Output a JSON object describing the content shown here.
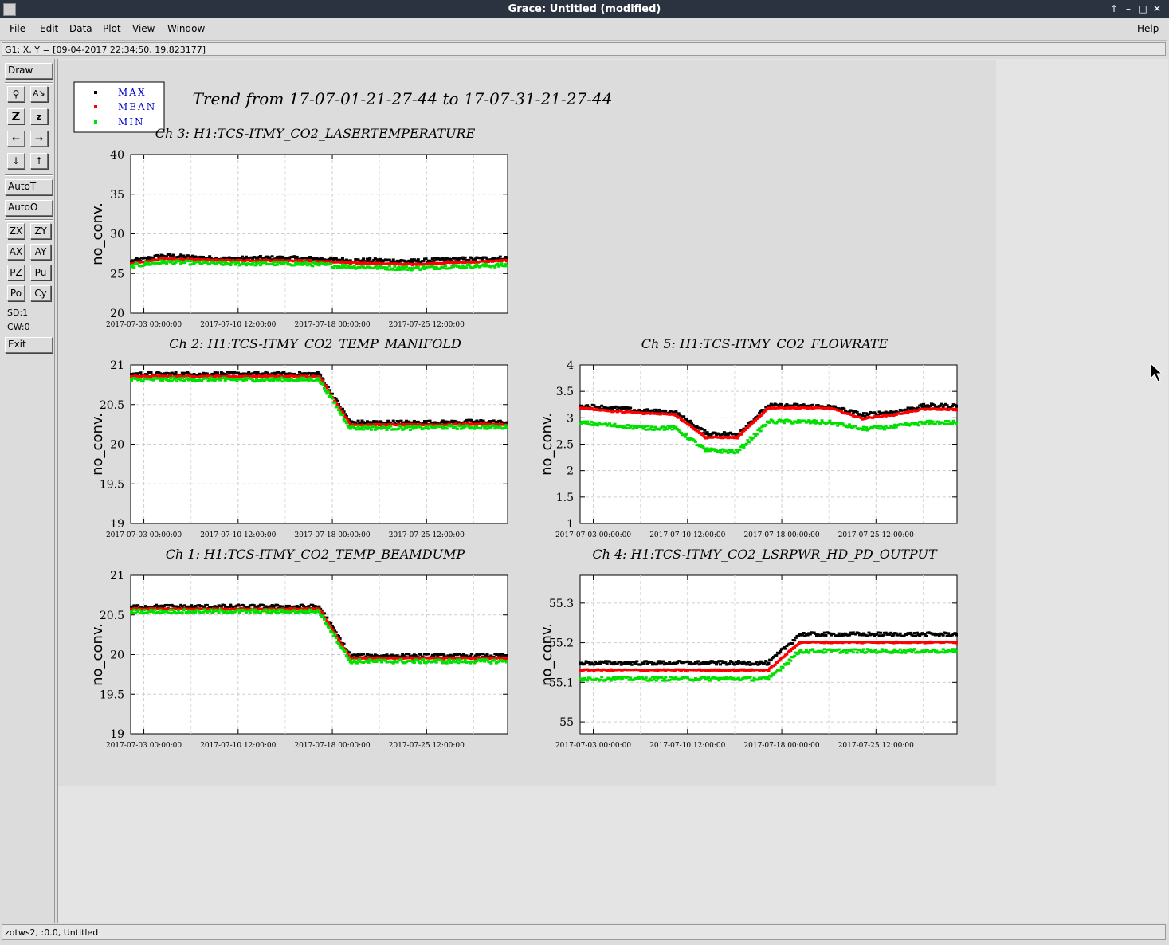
{
  "window": {
    "title": "Grace: Untitled (modified)"
  },
  "menu": {
    "file": "File",
    "edit": "Edit",
    "data": "Data",
    "plot": "Plot",
    "view": "View",
    "window": "Window",
    "help": "Help"
  },
  "locator": "G1: X, Y = [09-04-2017 22:34:50, 19.823177]",
  "toolbar": {
    "draw": "Draw",
    "autot": "AutoT",
    "autoo": "AutoO",
    "zx": "ZX",
    "zy": "ZY",
    "ax": "AX",
    "ay": "AY",
    "pz": "PZ",
    "pu": "Pu",
    "po": "Po",
    "cy": "Cy",
    "sd": "SD:1",
    "cw": "CW:0",
    "exit": "Exit"
  },
  "status": "zotws2, :0.0, Untitled",
  "plot": {
    "main_title": "Trend from 17-07-01-21-27-44 to 17-07-31-21-27-44",
    "legend": [
      "MAX",
      "MEAN",
      "MIN"
    ],
    "colors": {
      "max": "#000000",
      "mean": "#ff0000",
      "min": "#00e000",
      "legend_text": "#0000cc"
    }
  },
  "chart_data": [
    {
      "type": "scatter",
      "title": "Ch 3: H1:TCS-ITMY_CO2_LASERTEMPERATURE",
      "ylabel": "no_conv.",
      "ylim": [
        20,
        40
      ],
      "yticks": [
        "20",
        "25",
        "30",
        "35",
        "40"
      ],
      "xticks": [
        "2017-07-03 00:00:00",
        "2017-07-10 12:00:00",
        "2017-07-18 00:00:00",
        "2017-07-25 12:00:00"
      ],
      "grid": true,
      "series": [
        {
          "name": "MAX",
          "color": "#000000",
          "values": [
            26.5,
            27.2,
            27.0,
            26.8,
            26.9,
            26.9,
            26.8,
            26.6,
            26.6,
            26.5,
            26.7,
            26.8,
            26.9
          ]
        },
        {
          "name": "MEAN",
          "color": "#ff0000",
          "values": [
            26.2,
            26.8,
            26.7,
            26.6,
            26.6,
            26.6,
            26.5,
            26.3,
            26.2,
            26.1,
            26.3,
            26.4,
            26.6
          ]
        },
        {
          "name": "MIN",
          "color": "#00e000",
          "values": [
            25.9,
            26.4,
            26.3,
            26.2,
            26.2,
            26.2,
            26.1,
            25.8,
            25.7,
            25.6,
            25.8,
            25.9,
            26.0
          ]
        }
      ]
    },
    {
      "type": "scatter",
      "title": "Ch 2: H1:TCS-ITMY_CO2_TEMP_MANIFOLD",
      "ylabel": "no_conv.",
      "ylim": [
        19,
        21
      ],
      "yticks": [
        "19",
        "19.5",
        "20",
        "20.5",
        "21"
      ],
      "xticks": [
        "2017-07-03 00:00:00",
        "2017-07-10 12:00:00",
        "2017-07-18 00:00:00",
        "2017-07-25 12:00:00"
      ],
      "grid": true,
      "series": [
        {
          "name": "MAX",
          "color": "#000000",
          "values": [
            20.88,
            20.88,
            20.88,
            20.88,
            20.88,
            20.88,
            20.88,
            20.27,
            20.27,
            20.27,
            20.27,
            20.28,
            20.27
          ]
        },
        {
          "name": "MEAN",
          "color": "#ff0000",
          "values": [
            20.85,
            20.85,
            20.85,
            20.85,
            20.85,
            20.85,
            20.85,
            20.24,
            20.24,
            20.24,
            20.24,
            20.25,
            20.24
          ]
        },
        {
          "name": "MIN",
          "color": "#00e000",
          "values": [
            20.81,
            20.81,
            20.81,
            20.81,
            20.81,
            20.81,
            20.81,
            20.2,
            20.2,
            20.2,
            20.21,
            20.21,
            20.21
          ]
        }
      ]
    },
    {
      "type": "scatter",
      "title": "Ch 5: H1:TCS-ITMY_CO2_FLOWRATE",
      "ylabel": "no_conv.",
      "ylim": [
        1,
        4
      ],
      "yticks": [
        "1",
        "1.5",
        "2",
        "2.5",
        "3",
        "3.5",
        "4"
      ],
      "xticks": [
        "2017-07-03 00:00:00",
        "2017-07-10 12:00:00",
        "2017-07-18 00:00:00",
        "2017-07-25 12:00:00"
      ],
      "grid": true,
      "series": [
        {
          "name": "MAX",
          "color": "#000000",
          "values": [
            3.22,
            3.18,
            3.12,
            3.1,
            2.7,
            2.68,
            3.22,
            3.22,
            3.2,
            3.05,
            3.1,
            3.22,
            3.22
          ]
        },
        {
          "name": "MEAN",
          "color": "#ff0000",
          "values": [
            3.18,
            3.12,
            3.08,
            3.06,
            2.62,
            2.62,
            3.18,
            3.18,
            3.17,
            2.98,
            3.05,
            3.16,
            3.15
          ]
        },
        {
          "name": "MIN",
          "color": "#00e000",
          "values": [
            2.9,
            2.85,
            2.8,
            2.8,
            2.38,
            2.35,
            2.92,
            2.92,
            2.9,
            2.78,
            2.82,
            2.9,
            2.9
          ]
        }
      ]
    },
    {
      "type": "scatter",
      "title": "Ch 1: H1:TCS-ITMY_CO2_TEMP_BEAMDUMP",
      "ylabel": "no_conv.",
      "ylim": [
        19,
        21
      ],
      "yticks": [
        "19",
        "19.5",
        "20",
        "20.5",
        "21"
      ],
      "xticks": [
        "2017-07-03 00:00:00",
        "2017-07-10 12:00:00",
        "2017-07-18 00:00:00",
        "2017-07-25 12:00:00"
      ],
      "grid": true,
      "series": [
        {
          "name": "MAX",
          "color": "#000000",
          "values": [
            20.6,
            20.6,
            20.6,
            20.6,
            20.6,
            20.6,
            20.6,
            19.98,
            19.98,
            19.98,
            19.98,
            19.98,
            19.98
          ]
        },
        {
          "name": "MEAN",
          "color": "#ff0000",
          "values": [
            20.57,
            20.57,
            20.57,
            20.57,
            20.57,
            20.57,
            20.57,
            19.95,
            19.95,
            19.95,
            19.95,
            19.95,
            19.95
          ]
        },
        {
          "name": "MIN",
          "color": "#00e000",
          "values": [
            20.54,
            20.54,
            20.54,
            20.54,
            20.54,
            20.54,
            20.54,
            19.91,
            19.91,
            19.91,
            19.91,
            19.91,
            19.91
          ]
        }
      ]
    },
    {
      "type": "scatter",
      "title": "Ch 4: H1:TCS-ITMY_CO2_LSRPWR_HD_PD_OUTPUT",
      "ylabel": "no_conv.",
      "ylim": [
        54.97,
        55.37
      ],
      "yticks": [
        "55",
        "55.1",
        "55.2",
        "55.3"
      ],
      "xticks": [
        "2017-07-03 00:00:00",
        "2017-07-10 12:00:00",
        "2017-07-18 00:00:00",
        "2017-07-25 12:00:00"
      ],
      "grid": true,
      "series": [
        {
          "name": "MAX",
          "color": "#000000",
          "values": [
            55.148,
            55.148,
            55.148,
            55.148,
            55.148,
            55.148,
            55.148,
            55.22,
            55.22,
            55.22,
            55.22,
            55.22,
            55.22
          ]
        },
        {
          "name": "MEAN",
          "color": "#ff0000",
          "values": [
            55.13,
            55.13,
            55.13,
            55.13,
            55.13,
            55.13,
            55.13,
            55.2,
            55.2,
            55.2,
            55.2,
            55.2,
            55.2
          ]
        },
        {
          "name": "MIN",
          "color": "#00e000",
          "values": [
            55.108,
            55.108,
            55.108,
            55.108,
            55.108,
            55.108,
            55.108,
            55.178,
            55.178,
            55.178,
            55.178,
            55.178,
            55.178
          ]
        }
      ]
    }
  ]
}
